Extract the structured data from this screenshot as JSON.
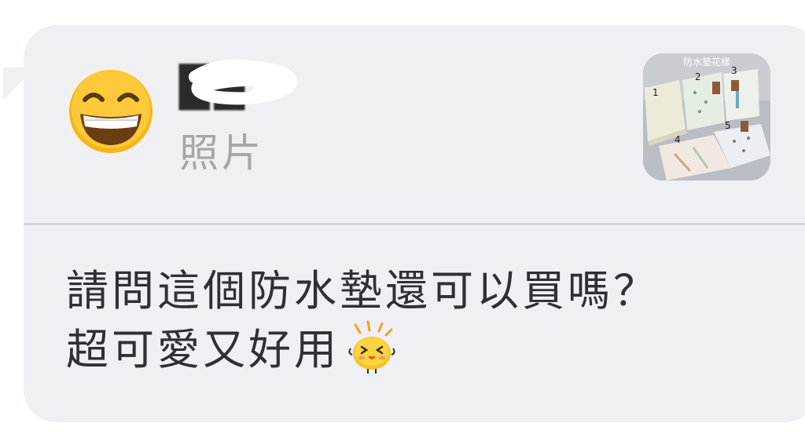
{
  "reply_preview": {
    "sender_name": "██",
    "type_label": "照片",
    "avatar_icon": "grinning-face-emoji",
    "thumbnail": {
      "caption": "防水墊花樣",
      "item_numbers": [
        "1",
        "2",
        "3",
        "4",
        "5"
      ]
    }
  },
  "message": {
    "line1": "請問這個防水墊還可以買嗎？",
    "line2": "超可愛又好用",
    "trailing_sticker": "laughing-chick-sticker"
  },
  "colors": {
    "bubble": "#eff0f3",
    "divider": "#d2d5dc",
    "text": "#2e3035",
    "muted": "#a4a6aa"
  }
}
